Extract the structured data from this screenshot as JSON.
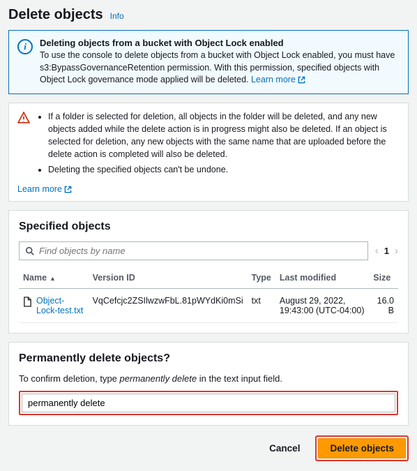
{
  "header": {
    "title": "Delete objects",
    "info_label": "Info"
  },
  "info_alert": {
    "title": "Deleting objects from a bucket with Object Lock enabled",
    "body": "To use the console to delete objects from a bucket with Object Lock enabled, you must have s3:BypassGovernanceRetention permission. With this permission, specified objects with Object Lock governance mode applied will be deleted.",
    "learn_more": "Learn more"
  },
  "warning_alert": {
    "items": [
      "If a folder is selected for deletion, all objects in the folder will be deleted, and any new objects added while the delete action is in progress might also be deleted. If an object is selected for deletion, any new objects with the same name that are uploaded before the delete action is completed will also be deleted.",
      "Deleting the specified objects can't be undone."
    ],
    "learn_more": "Learn more"
  },
  "specified": {
    "title": "Specified objects",
    "search_placeholder": "Find objects by name",
    "pager_current": "1",
    "columns": {
      "name": "Name",
      "version": "Version ID",
      "type": "Type",
      "modified": "Last modified",
      "size": "Size"
    },
    "rows": [
      {
        "name": "Object-Lock-test.txt",
        "version": "VqCefcjc2ZSIlwzwFbL.81pWYdKi0mSi",
        "type": "txt",
        "modified": "August 29, 2022, 19:43:00 (UTC-04:00)",
        "size": "16.0 B"
      }
    ]
  },
  "confirm": {
    "title": "Permanently delete objects?",
    "prompt_prefix": "To confirm deletion, type ",
    "prompt_phrase": "permanently delete",
    "prompt_suffix": " in the text input field.",
    "input_value": "permanently delete"
  },
  "footer": {
    "cancel": "Cancel",
    "delete": "Delete objects"
  }
}
